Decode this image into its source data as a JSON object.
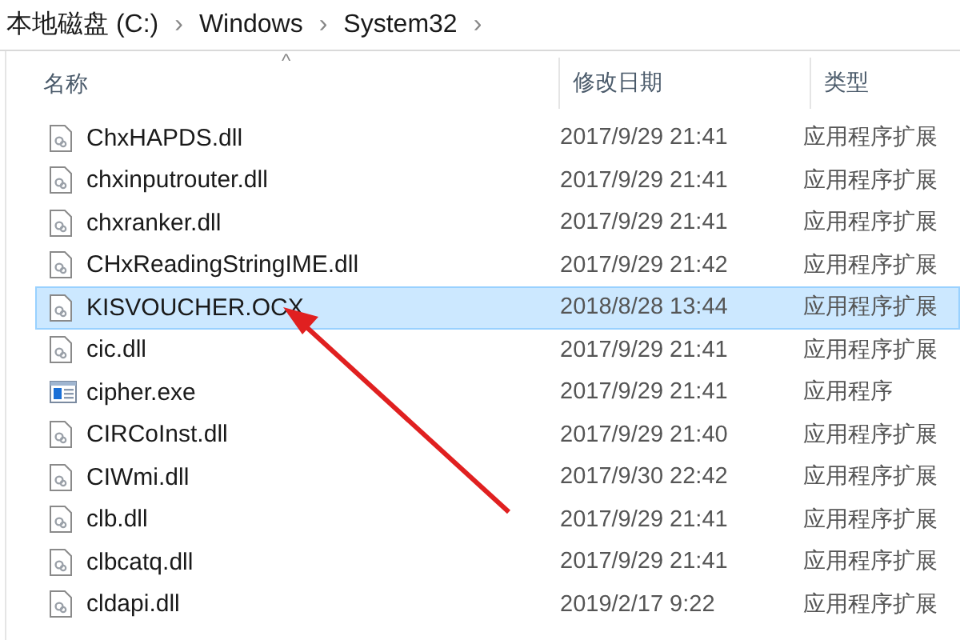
{
  "breadcrumb": [
    {
      "label": "本地磁盘 (C:)"
    },
    {
      "label": "Windows"
    },
    {
      "label": "System32"
    }
  ],
  "breadcrumb_separator": "›",
  "columns": [
    {
      "label": "名称",
      "sorted": true
    },
    {
      "label": "修改日期",
      "sorted": false
    },
    {
      "label": "类型",
      "sorted": false
    }
  ],
  "sort_caret": "^",
  "rows": [
    {
      "name": "ChxHAPDS.dll",
      "date": "2017/9/29 21:41",
      "type": "应用程序扩展",
      "kind": "dll",
      "selected": false
    },
    {
      "name": "chxinputrouter.dll",
      "date": "2017/9/29 21:41",
      "type": "应用程序扩展",
      "kind": "dll",
      "selected": false
    },
    {
      "name": "chxranker.dll",
      "date": "2017/9/29 21:41",
      "type": "应用程序扩展",
      "kind": "dll",
      "selected": false
    },
    {
      "name": "CHxReadingStringIME.dll",
      "date": "2017/9/29 21:42",
      "type": "应用程序扩展",
      "kind": "dll",
      "selected": false
    },
    {
      "name": "KISVOUCHER.OCX",
      "date": "2018/8/28 13:44",
      "type": "应用程序扩展",
      "kind": "dll",
      "selected": true
    },
    {
      "name": "cic.dll",
      "date": "2017/9/29 21:41",
      "type": "应用程序扩展",
      "kind": "dll",
      "selected": false
    },
    {
      "name": "cipher.exe",
      "date": "2017/9/29 21:41",
      "type": "应用程序",
      "kind": "exe",
      "selected": false
    },
    {
      "name": "CIRCoInst.dll",
      "date": "2017/9/29 21:40",
      "type": "应用程序扩展",
      "kind": "dll",
      "selected": false
    },
    {
      "name": "CIWmi.dll",
      "date": "2017/9/30 22:42",
      "type": "应用程序扩展",
      "kind": "dll",
      "selected": false
    },
    {
      "name": "clb.dll",
      "date": "2017/9/29 21:41",
      "type": "应用程序扩展",
      "kind": "dll",
      "selected": false
    },
    {
      "name": "clbcatq.dll",
      "date": "2017/9/29 21:41",
      "type": "应用程序扩展",
      "kind": "dll",
      "selected": false
    },
    {
      "name": "cldapi.dll",
      "date": "2019/2/17 9:22",
      "type": "应用程序扩展",
      "kind": "dll",
      "selected": false
    }
  ]
}
